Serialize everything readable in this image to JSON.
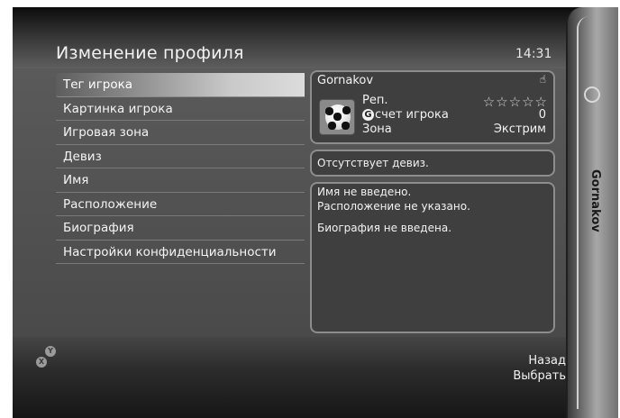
{
  "header": {
    "title": "Изменение профиля",
    "time": "14:31"
  },
  "menu": {
    "items": [
      {
        "label": "Тег игрока",
        "selected": true
      },
      {
        "label": "Картинка игрока"
      },
      {
        "label": "Игровая зона"
      },
      {
        "label": "Девиз"
      },
      {
        "label": "Имя"
      },
      {
        "label": "Расположение"
      },
      {
        "label": "Биография"
      },
      {
        "label": "Настройки конфиденциальности"
      }
    ]
  },
  "gamer_card": {
    "gamertag": "Gornakov",
    "rep_label": "Реп.",
    "rep_stars_filled": 0,
    "rep_stars_total": 5,
    "score_label": "счет игрока",
    "score_badge": "G",
    "score_value": "0",
    "zone_label": "Зона",
    "zone_value": "Экстрим"
  },
  "motto": {
    "text": "Отсутствует девиз."
  },
  "bio": {
    "name": "Имя не введено.",
    "location": "Расположение не указано.",
    "biography": "Биография не введена."
  },
  "footer": {
    "back_label": "Назад",
    "back_button": "B",
    "select_label": "Выбрать",
    "select_button": "A",
    "y_button": "Y",
    "x_button": "X"
  },
  "blade": {
    "gamertag": "Gornakov"
  }
}
